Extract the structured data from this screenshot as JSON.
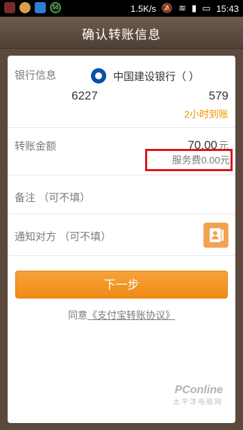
{
  "statusbar": {
    "speed": "1.5K/s",
    "time": "15:43",
    "app_icon_badge": "56"
  },
  "titlebar": {
    "title": "确认转账信息"
  },
  "bank_info": {
    "label": "银行信息",
    "bank_name": "中国建设银行（        ）",
    "account_prefix": "6227",
    "account_suffix": "579",
    "arrival_time": "2小时到账",
    "logo_icon": "ccb-logo-icon"
  },
  "amount": {
    "label": "转账金额",
    "value": "70.00",
    "unit": "元",
    "fee_text": "服务费0.00元"
  },
  "remark": {
    "label": "备注  （可不填）"
  },
  "notify": {
    "label": "通知对方  （可不填）",
    "contact_icon": "contacts-book-icon"
  },
  "actions": {
    "next_label": "下一步",
    "agree_prefix": "同意",
    "agree_link": "《支付宝转账协议》"
  },
  "watermark": {
    "brand": "PConline",
    "cn": "太平洋电脑网"
  },
  "colors": {
    "accent": "#f29400",
    "button": "#ef8b16",
    "highlight_box": "#d9141b",
    "titlebar": "#5a4a3e"
  }
}
